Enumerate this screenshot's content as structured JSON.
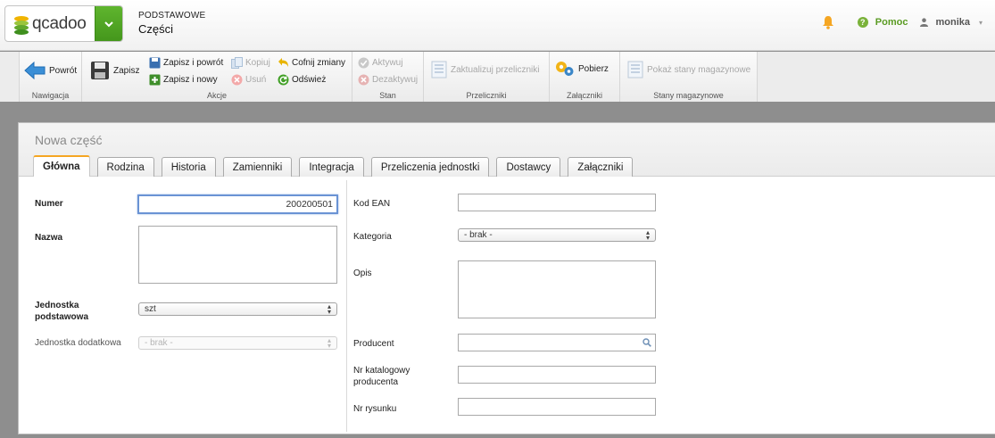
{
  "header": {
    "logo_text": "qcadoo",
    "section": "PODSTAWOWE",
    "page": "Części",
    "help_label": "Pomoc",
    "user_name": "monika"
  },
  "toolbar": {
    "groups": {
      "nav": "Nawigacja",
      "actions": "Akcje",
      "state": "Stan",
      "converters": "Przeliczniki",
      "attachments": "Załączniki",
      "stock": "Stany magazynowe"
    },
    "back": "Powrót",
    "save": "Zapisz",
    "save_back": "Zapisz i powrót",
    "save_new": "Zapisz i nowy",
    "copy": "Kopiuj",
    "delete": "Usuń",
    "undo": "Cofnij zmiany",
    "refresh": "Odśwież",
    "activate": "Aktywuj",
    "deactivate": "Dezaktywuj",
    "update_converters": "Zaktualizuj przeliczniki",
    "download": "Pobierz",
    "show_stock": "Pokaż stany magazynowe"
  },
  "panel": {
    "title": "Nowa część",
    "tabs": [
      "Główna",
      "Rodzina",
      "Historia",
      "Zamienniki",
      "Integracja",
      "Przeliczenia jednostki",
      "Dostawcy",
      "Załączniki"
    ]
  },
  "form": {
    "number_label": "Numer",
    "number_value": "200200501",
    "name_label": "Nazwa",
    "base_unit_label_1": "Jednostka",
    "base_unit_label_2": "podstawowa",
    "base_unit_value": "szt",
    "extra_unit_label": "Jednostka dodatkowa",
    "extra_unit_value": "- brak -",
    "ean_label": "Kod EAN",
    "category_label": "Kategoria",
    "category_value": "- brak -",
    "description_label": "Opis",
    "producer_label": "Producent",
    "catalog_label_1": "Nr katalogowy",
    "catalog_label_2": "producenta",
    "drawing_label": "Nr rysunku"
  },
  "colors": {
    "accent_green": "#5fb52e",
    "active_tab": "#f5a623",
    "focus_border": "#6a93d4"
  }
}
